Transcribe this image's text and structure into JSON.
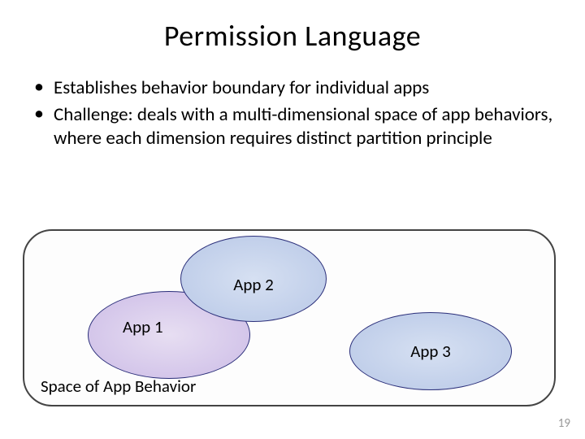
{
  "title": "Permission Language",
  "bullets": [
    "Establishes behavior boundary for individual apps",
    "Challenge: deals with a multi-dimensional space of app behaviors, where each dimension requires distinct partition principle"
  ],
  "diagram": {
    "app1": "App 1",
    "app2": "App 2",
    "app3": "App 3",
    "caption": "Space of App Behavior"
  },
  "page_number": "19"
}
